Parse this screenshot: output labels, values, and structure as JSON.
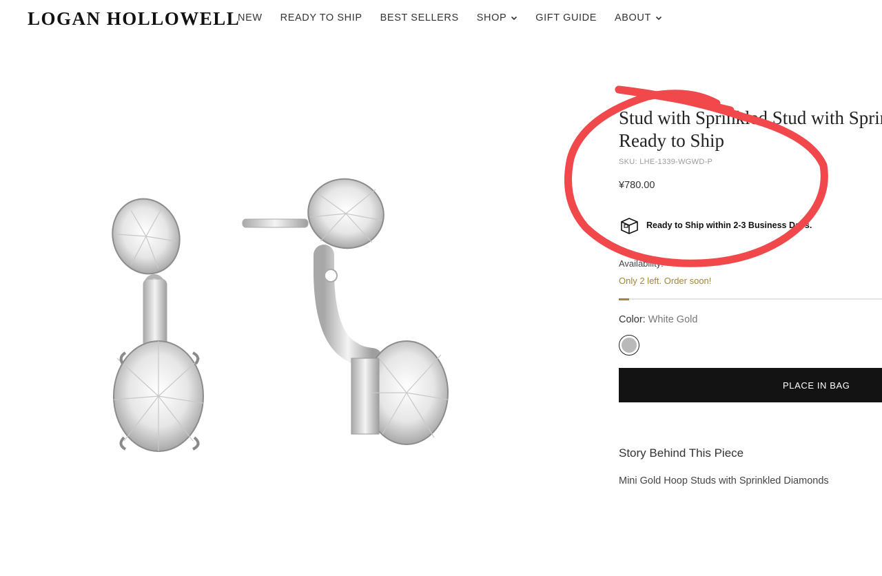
{
  "brand": {
    "logo": "LOGAN HOLLOWELL"
  },
  "nav": [
    {
      "label": "NEW"
    },
    {
      "label": "READY TO SHIP"
    },
    {
      "label": "BEST SELLERS"
    },
    {
      "label": "SHOP"
    },
    {
      "label": "GIFT GUIDE"
    },
    {
      "label": "ABOUT"
    }
  ],
  "product": {
    "title_line1": "Stud with Sprinkled Stud with Sprinkled",
    "title_line2": "Ready to Ship",
    "sku": "SKU: LHE-1339-WGWD-P",
    "price": "¥780.00",
    "shipping": "Ready to Ship within 2-3 Business Days.",
    "availability": "Availability:",
    "stock_note": "Only 2 left. Order soon!",
    "stock_level": 0.04,
    "color_label": "Color:",
    "color_value": "White Gold",
    "swatch_color": "#b9b9b9",
    "add_to_bag": "PLACE IN BAG",
    "story_heading": "Story Behind This Piece",
    "story_text": "Mini Gold Hoop Studs with Sprinkled Diamonds"
  },
  "colors": {
    "accent_gold": "#a3863a",
    "button_bg": "#131313",
    "annotation": "#f0484b"
  },
  "icons": {
    "shipping": "box-icon",
    "chevron": "chevron-down-icon"
  }
}
